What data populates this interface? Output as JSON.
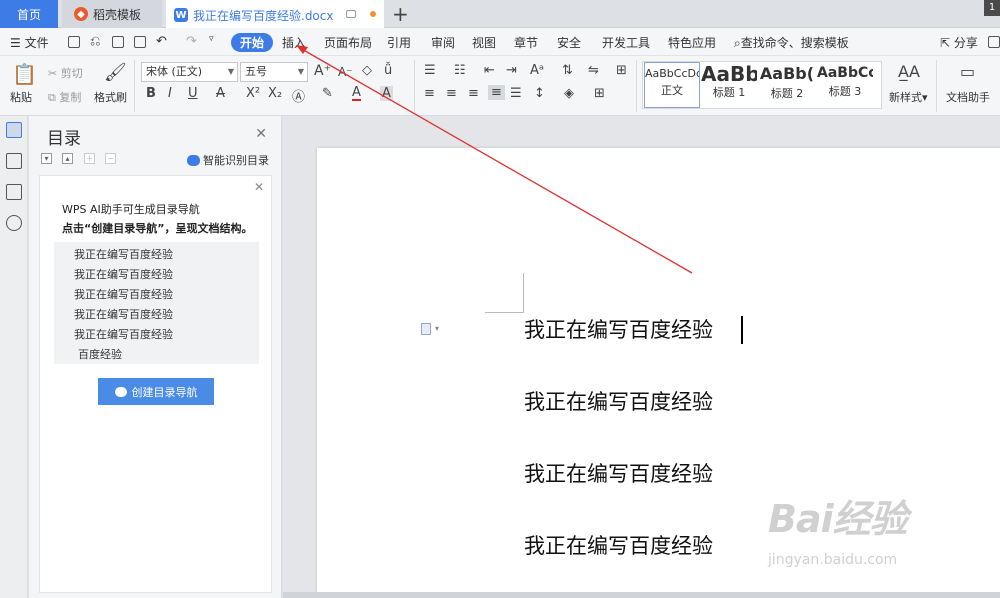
{
  "titlebar": {
    "home_tab": "首页",
    "tabs": [
      {
        "label": "稻壳模板"
      },
      {
        "label": "我正在编写百度经验.docx"
      }
    ],
    "new_tab": "+"
  },
  "menubar": {
    "file": "文件",
    "items": [
      "开始",
      "插入",
      "页面布局",
      "引用",
      "审阅",
      "视图",
      "章节",
      "安全",
      "开发工具",
      "特色应用"
    ],
    "active": "开始",
    "search": "查找命令、搜索模板",
    "share": "分享"
  },
  "ribbon": {
    "paste": "粘贴",
    "cut": "剪切",
    "copy": "复制",
    "format_painter": "格式刷",
    "font_name": "宋体 (正文)",
    "font_size": "五号",
    "styles": [
      {
        "preview": "AaBbCcDd",
        "label": "正文"
      },
      {
        "preview": "AaBb",
        "label": "标题 1"
      },
      {
        "preview": "AaBb(",
        "label": "标题 2"
      },
      {
        "preview": "AaBbCc",
        "label": "标题 3"
      }
    ],
    "new_style": "新样式",
    "doc_assistant": "文档助手"
  },
  "toc": {
    "title": "目录",
    "smart_label": "智能识别目录",
    "card_line1": "WPS AI助手可生成目录导航",
    "card_line2": "点击“创建目录导航”，呈现文档结构。",
    "items": [
      "我正在编写百度经验",
      "我正在编写百度经验",
      "我正在编写百度经验",
      "我正在编写百度经验",
      "我正在编写百度经验",
      "百度经验"
    ],
    "create_button": "创建目录导航"
  },
  "document": {
    "lines": [
      "我正在编写百度经验",
      "我正在编写百度经验",
      "我正在编写百度经验",
      "我正在编写百度经验"
    ]
  },
  "watermark": {
    "brand": "Bai经验",
    "url": "jingyan.baidu.com"
  },
  "colors": {
    "accent": "#3d7be6",
    "arrow": "#e03030"
  }
}
